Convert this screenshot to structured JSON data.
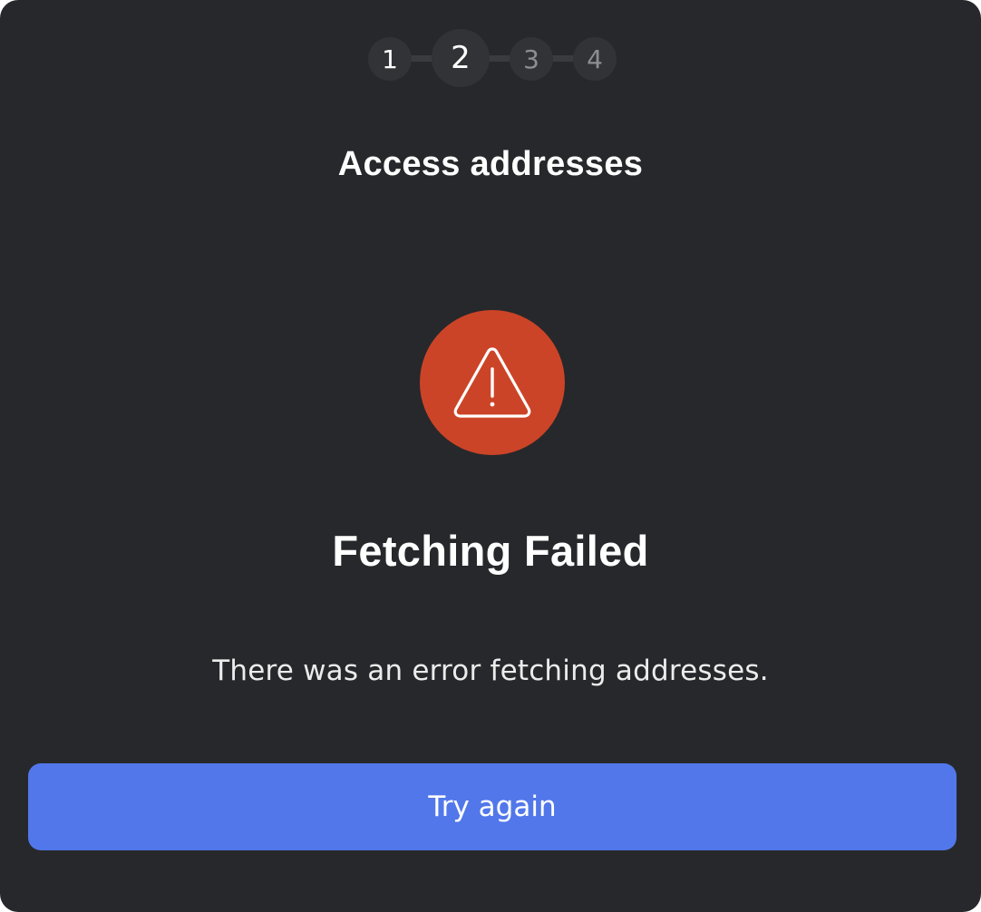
{
  "stepper": {
    "steps": [
      {
        "label": "1",
        "state": "done"
      },
      {
        "label": "2",
        "state": "active"
      },
      {
        "label": "3",
        "state": "pending"
      },
      {
        "label": "4",
        "state": "pending"
      }
    ]
  },
  "title": "Access addresses",
  "status": {
    "icon": "warning-icon",
    "icon_bg": "#cc4427",
    "heading": "Fetching Failed",
    "message": "There was an error fetching addresses."
  },
  "actions": {
    "try_again_label": "Try again",
    "accent": "#5277ea"
  },
  "colors": {
    "background": "#27282b",
    "step_bg": "#323337",
    "step_pending_text": "#8d8e92"
  }
}
